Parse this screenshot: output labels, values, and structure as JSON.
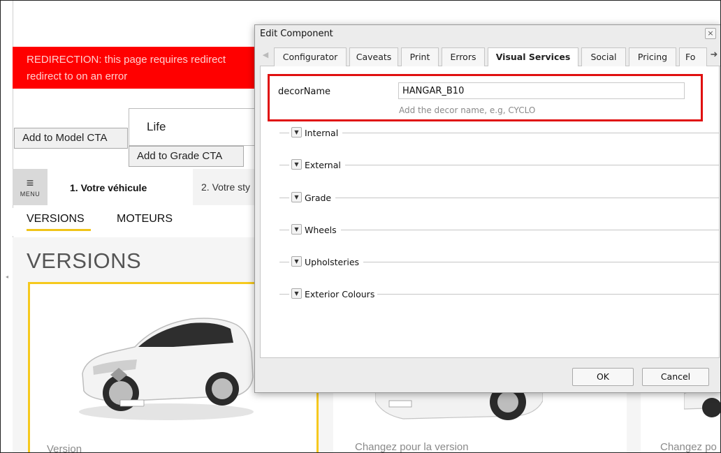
{
  "background_page": {
    "redirect_banner": {
      "line1": "REDIRECTION: this page requires redirect",
      "line2": "redirect to on an error",
      "color": "#ff0000"
    },
    "grade_box": {
      "label": "Life"
    },
    "add_model_cta": "Add to Model CTA",
    "add_grade_cta": "Add to Grade CTA",
    "nav": {
      "menu_label": "MENU",
      "step1": "1. Votre véhicule",
      "step2": "2. Votre sty"
    },
    "tabs": {
      "versions": "VERSIONS",
      "moteurs": "MOTEURS",
      "accent": "#f0c419"
    },
    "page_title": "VERSIONS",
    "cards": {
      "card1_label": "Version",
      "card2_label": "Changez pour la version",
      "card3_label": "Changez po"
    }
  },
  "dialog": {
    "title": "Edit Component",
    "close_glyph": "×",
    "tabs": [
      {
        "label": "Configurator"
      },
      {
        "label": "Caveats"
      },
      {
        "label": "Print"
      },
      {
        "label": "Errors"
      },
      {
        "label": "Visual Services"
      },
      {
        "label": "Social"
      },
      {
        "label": "Pricing"
      },
      {
        "label": "Fo"
      }
    ],
    "active_tab": "Visual Services",
    "field": {
      "label": "decorName",
      "value": "HANGAR_B10",
      "help": "Add the decor name, e.g, CYCLO"
    },
    "highlight_color": "#e01010",
    "sections": [
      {
        "title": "Internal"
      },
      {
        "title": "External"
      },
      {
        "title": "Grade"
      },
      {
        "title": "Wheels"
      },
      {
        "title": "Upholsteries"
      },
      {
        "title": "Exterior Colours"
      }
    ],
    "buttons": {
      "ok": "OK",
      "cancel": "Cancel"
    }
  }
}
